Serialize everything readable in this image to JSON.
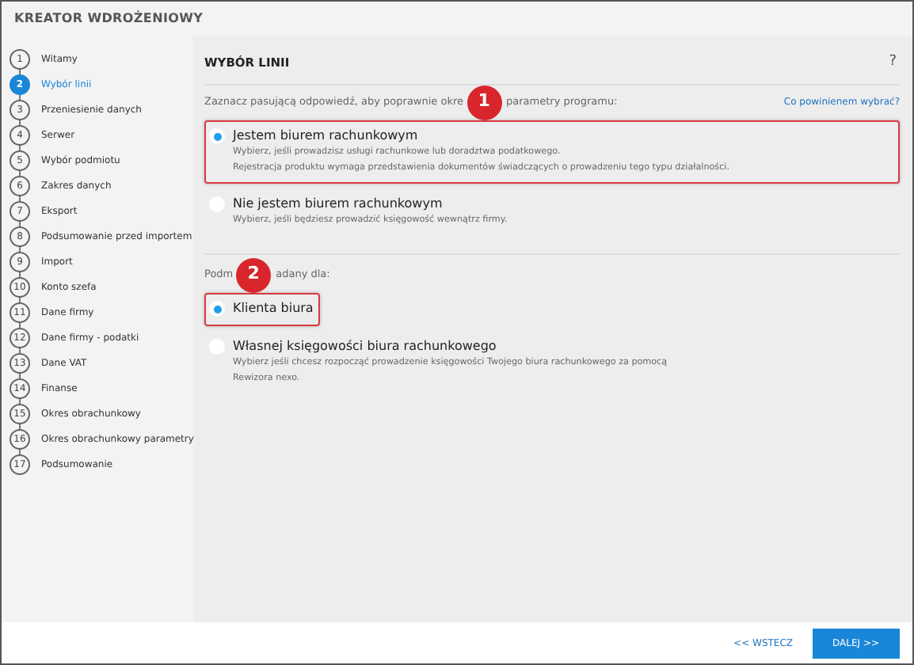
{
  "window": {
    "title": "KREATOR WDROŻENIOWY"
  },
  "steps": [
    {
      "number": "1",
      "label": "Witamy",
      "selected": false
    },
    {
      "number": "2",
      "label": "Wybór linii",
      "selected": true
    },
    {
      "number": "3",
      "label": "Przeniesienie danych",
      "selected": false
    },
    {
      "number": "4",
      "label": "Serwer",
      "selected": false
    },
    {
      "number": "5",
      "label": "Wybór podmiotu",
      "selected": false
    },
    {
      "number": "6",
      "label": "Zakres danych",
      "selected": false
    },
    {
      "number": "7",
      "label": "Eksport",
      "selected": false
    },
    {
      "number": "8",
      "label": "Podsumowanie przed importem",
      "selected": false
    },
    {
      "number": "9",
      "label": "Import",
      "selected": false
    },
    {
      "number": "10",
      "label": "Konto szefa",
      "selected": false
    },
    {
      "number": "11",
      "label": "Dane firmy",
      "selected": false
    },
    {
      "number": "12",
      "label": "Dane firmy - podatki",
      "selected": false
    },
    {
      "number": "13",
      "label": "Dane VAT",
      "selected": false
    },
    {
      "number": "14",
      "label": "Finanse",
      "selected": false
    },
    {
      "number": "15",
      "label": "Okres obrachunkowy",
      "selected": false
    },
    {
      "number": "16",
      "label": "Okres obrachunkowy parametry",
      "selected": false
    },
    {
      "number": "17",
      "label": "Podsumowanie",
      "selected": false
    }
  ],
  "page": {
    "heading": "WYBÓR LINII",
    "help": "?",
    "help_link": "Co powinienem wybrać?"
  },
  "groups": [
    {
      "prompt_before": "Zaznacz pasującą odpowiedź, aby poprawnie okre",
      "callout": "1",
      "prompt_after": "parametry programu:",
      "options": [
        {
          "label": "Jestem biurem rachunkowym",
          "description": [
            "Wybierz, jeśli prowadzisz usługi rachunkowe lub doradztwa podatkowego.",
            "Rejestracja produktu wymaga przedstawienia dokumentów świadczących o prowadzeniu tego typu działalności."
          ],
          "selected": true,
          "highlighted": true
        },
        {
          "label": "Nie jestem biurem rachunkowym",
          "description": [
            "Wybierz, jeśli będziesz prowadzić księgowość wewnątrz firmy."
          ],
          "selected": false,
          "highlighted": false
        }
      ]
    },
    {
      "prompt_before": "Podm",
      "callout": "2",
      "prompt_after": "adany dla:",
      "options": [
        {
          "label": "Klienta biura",
          "selected": true,
          "highlighted": true
        },
        {
          "label": "Własnej księgowości biura rachunkowego",
          "description": [
            "Wybierz jeśli chcesz rozpocząć prowadzenie księgowości Twojego biura rachunkowego za pomocą Rewizora nexo."
          ],
          "selected": false,
          "highlighted": false
        }
      ]
    }
  ],
  "footer": {
    "back": "<< WSTECZ",
    "next": "DALEJ >>"
  }
}
